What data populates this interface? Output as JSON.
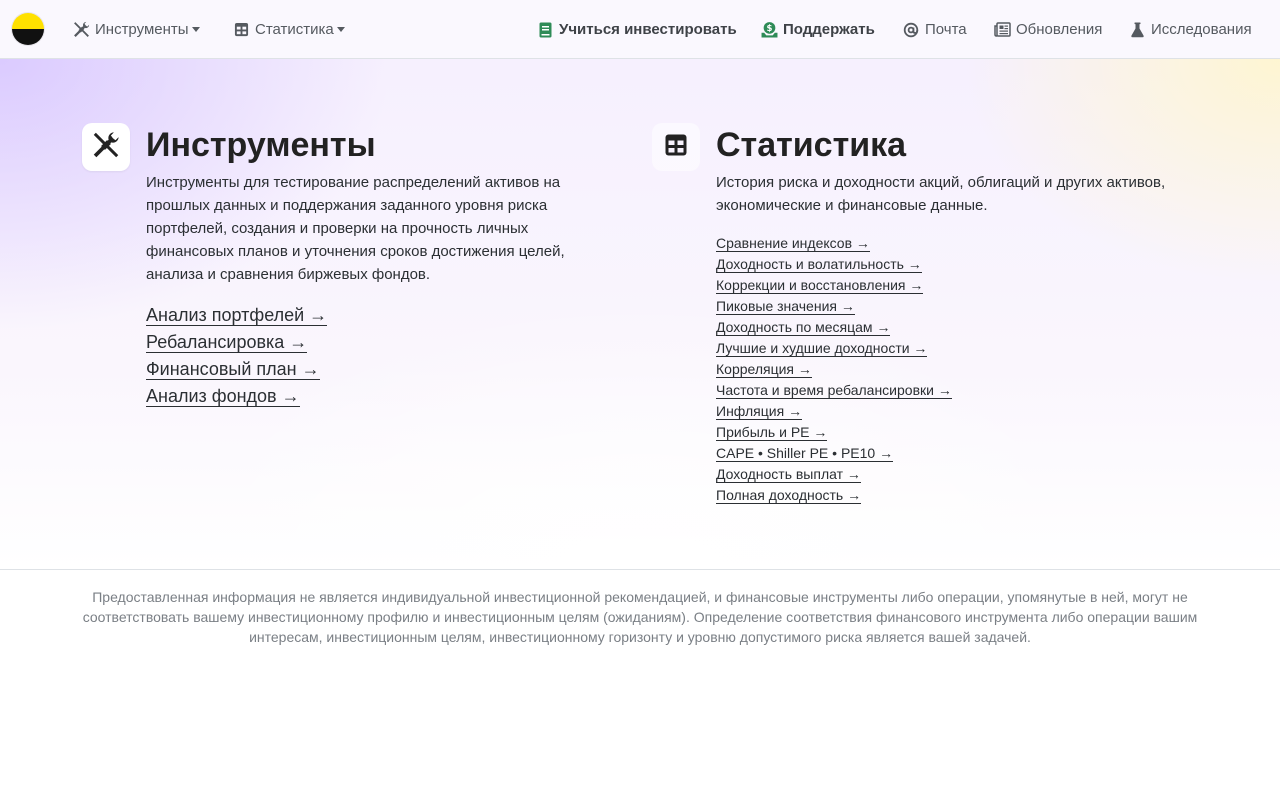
{
  "colors": {
    "accent_green": "#2e8b57",
    "nav_text": "#555a60",
    "logo_top": "#ffe100",
    "logo_bottom": "#111111"
  },
  "nav": {
    "tools": {
      "label": "Инструменты",
      "icon": "tools-icon"
    },
    "stats": {
      "label": "Статистика",
      "icon": "table-icon"
    },
    "learn": {
      "label": "Учиться инвестировать",
      "icon": "book-icon"
    },
    "support": {
      "label": "Поддержать",
      "icon": "donate-icon"
    },
    "mail": {
      "label": "Почта",
      "icon": "at-sign-icon"
    },
    "updates": {
      "label": "Обновления",
      "icon": "newspaper-icon"
    },
    "research": {
      "label": "Исследования",
      "icon": "flask-icon"
    }
  },
  "tools": {
    "title": "Инструменты",
    "description": "Инструменты для тестирование распределений активов на прошлых данных и поддержания заданного уровня риска портфелей, создания и проверки на прочность личных финансовых планов и уточнения сроков достижения целей, анализа и сравнения биржевых фондов.",
    "links": [
      "Анализ портфелей →",
      "Ребалансировка →",
      "Финансовый план →",
      "Анализ фондов →"
    ]
  },
  "stats": {
    "title": "Статистика",
    "description": "История риска и доходности акций, облигаций и других активов, экономические и финансовые данные.",
    "links": [
      "Сравнение индексов →",
      "Доходность и волатильность →",
      "Коррекции и восстановления →",
      "Пиковые значения →",
      "Доходность по месяцам →",
      "Лучшие и худшие доходности →",
      "Корреляция →",
      "Частота и время ребалансировки →",
      "Инфляция →",
      "Прибыль и PE →",
      "CAPE • Shiller PE • PE10 →",
      "Доходность выплат →",
      "Полная доходность →"
    ]
  },
  "disclaimer": "Предоставленная информация не является индивидуальной инвестиционной рекомендацией, и финансовые инструменты либо операции, упомянутые в ней, могут не соответствовать вашему инвестиционному профилю и инвестиционным целям (ожиданиям). Определение соответствия финансового инструмента либо операции вашим интересам, инвестиционным целям, инвестиционному горизонту и уровню допустимого риска является вашей задачей."
}
